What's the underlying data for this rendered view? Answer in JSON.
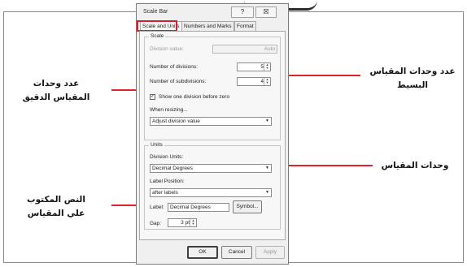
{
  "dialog": {
    "title": "Scale Bar",
    "help_btn": "?",
    "close_btn": "☒",
    "tabs": [
      {
        "label": "Scale and Units",
        "active": true
      },
      {
        "label": "Numbers and Marks",
        "active": false
      },
      {
        "label": "Format",
        "active": false
      }
    ],
    "scale": {
      "group_label": "Scale",
      "division_value_label": "Division value:",
      "division_value": "Auto",
      "num_divisions_label": "Number of divisions:",
      "num_divisions_value": "5",
      "num_subdivisions_label": "Number of subdivisions:",
      "num_subdivisions_value": "4",
      "show_one_division_label": "Show one division before zero",
      "show_one_division_checked": true,
      "when_resizing_label": "When resizing...",
      "when_resizing_value": "Adjust division value"
    },
    "units": {
      "group_label": "Units",
      "division_units_label": "Division Units:",
      "division_units_value": "Decimal Degrees",
      "label_position_label": "Label Position:",
      "label_position_value": "after labels",
      "label_label": "Label:",
      "label_value": "Decimal Degrees",
      "symbol_btn": "Symbol...",
      "gap_label": "Gap:",
      "gap_value": "3 pt"
    },
    "buttons": {
      "ok": "OK",
      "cancel": "Cancel",
      "apply": "Apply"
    }
  },
  "annotations": {
    "right_top_line1": "عدد وحدات المقياس",
    "right_top_line2": "البسيط",
    "right_middle": "وحدات المقياس",
    "left_top_line1": "عدد وحدات",
    "left_top_line2": "المقياس الدقيق",
    "left_bottom_line1": "النص المكتوب",
    "left_bottom_line2": "علي المقياس"
  },
  "colors": {
    "arrow": "#e0202a",
    "highlight": "#d3202a"
  }
}
